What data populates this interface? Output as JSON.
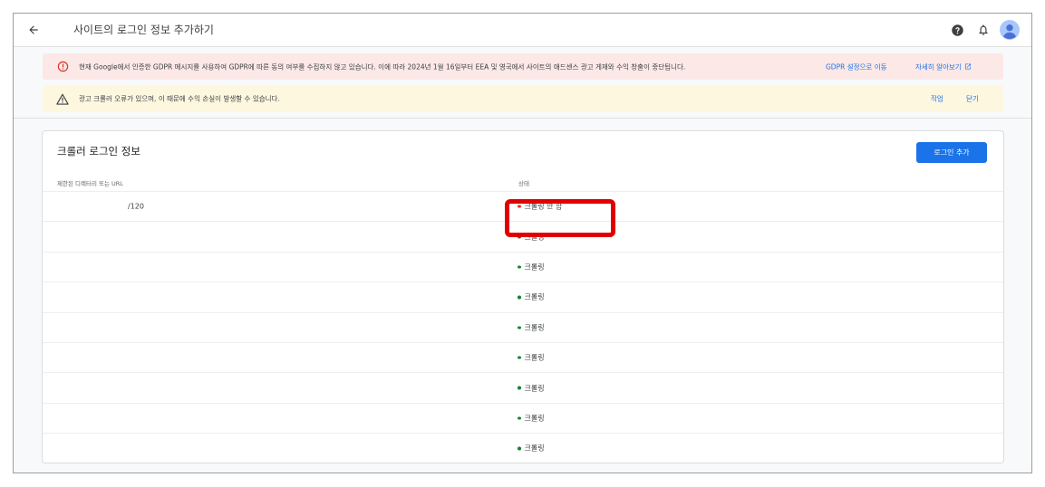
{
  "header": {
    "title": "사이트의 로그인 정보 추가하기",
    "back_icon": "arrow-left-icon",
    "help_icon": "help-icon",
    "notifications_icon": "bell-icon",
    "avatar_icon": "account-icon"
  },
  "banners": {
    "error": {
      "icon": "error-icon",
      "text": "현재 Google에서 인증한 GDPR 메시지를 사용하여 GDPR에 따른 동의 여부를 수집하지 않고 있습니다. 이에 따라 2024년 1월 16일부터 EEA 및 영국에서 사이트의 애드센스 광고 게재와 수익 창출이 중단됩니다.",
      "action1": "GDPR 설정으로 이동",
      "action2": "자세히 알아보기"
    },
    "warning": {
      "icon": "warning-icon",
      "text": "광고 크롤러 오류가 있으며, 이 때문에 수익 손실이 발생할 수 있습니다.",
      "action1": "작업",
      "action2": "닫기"
    }
  },
  "card": {
    "title": "크롤러 로그인 정보",
    "add_button": "로그인 추가",
    "columns": [
      "제한된 디렉터리 또는 URL",
      "상태"
    ],
    "rows": [
      {
        "url": "/120",
        "status": "크롤링 안 함",
        "status_color": "#d93025"
      },
      {
        "url": "",
        "status": "크롤링",
        "status_color": "#188038"
      },
      {
        "url": "",
        "status": "크롤링",
        "status_color": "#188038"
      },
      {
        "url": "",
        "status": "크롤링",
        "status_color": "#188038"
      },
      {
        "url": "",
        "status": "크롤링",
        "status_color": "#188038"
      },
      {
        "url": "",
        "status": "크롤링",
        "status_color": "#188038"
      },
      {
        "url": "",
        "status": "크롤링",
        "status_color": "#188038"
      },
      {
        "url": "",
        "status": "크롤링",
        "status_color": "#188038"
      },
      {
        "url": "",
        "status": "크롤링",
        "status_color": "#188038"
      }
    ]
  },
  "colors": {
    "accent": "#1a73e8",
    "error_bg": "#fce8e6",
    "warning_bg": "#fef7e0",
    "highlight": "#e00000"
  }
}
